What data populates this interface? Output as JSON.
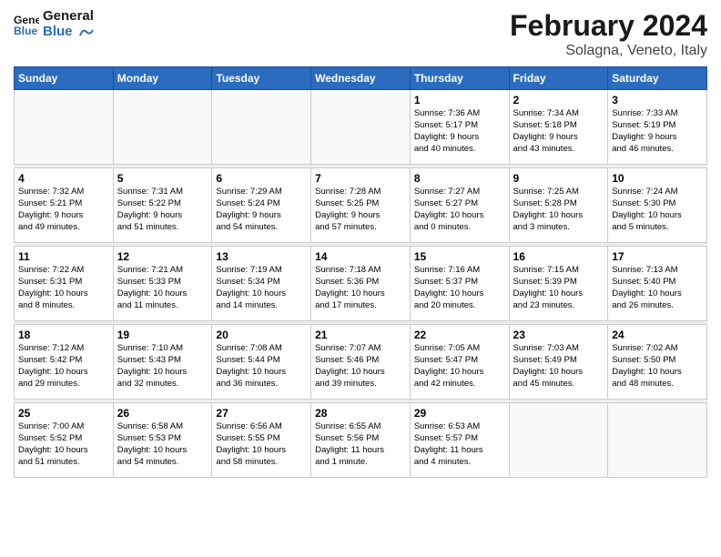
{
  "header": {
    "logo_line1": "General",
    "logo_line2": "Blue",
    "title": "February 2024",
    "subtitle": "Solagna, Veneto, Italy"
  },
  "days_of_week": [
    "Sunday",
    "Monday",
    "Tuesday",
    "Wednesday",
    "Thursday",
    "Friday",
    "Saturday"
  ],
  "weeks": [
    [
      {
        "day": "",
        "info": ""
      },
      {
        "day": "",
        "info": ""
      },
      {
        "day": "",
        "info": ""
      },
      {
        "day": "",
        "info": ""
      },
      {
        "day": "1",
        "info": "Sunrise: 7:36 AM\nSunset: 5:17 PM\nDaylight: 9 hours\nand 40 minutes."
      },
      {
        "day": "2",
        "info": "Sunrise: 7:34 AM\nSunset: 5:18 PM\nDaylight: 9 hours\nand 43 minutes."
      },
      {
        "day": "3",
        "info": "Sunrise: 7:33 AM\nSunset: 5:19 PM\nDaylight: 9 hours\nand 46 minutes."
      }
    ],
    [
      {
        "day": "4",
        "info": "Sunrise: 7:32 AM\nSunset: 5:21 PM\nDaylight: 9 hours\nand 49 minutes."
      },
      {
        "day": "5",
        "info": "Sunrise: 7:31 AM\nSunset: 5:22 PM\nDaylight: 9 hours\nand 51 minutes."
      },
      {
        "day": "6",
        "info": "Sunrise: 7:29 AM\nSunset: 5:24 PM\nDaylight: 9 hours\nand 54 minutes."
      },
      {
        "day": "7",
        "info": "Sunrise: 7:28 AM\nSunset: 5:25 PM\nDaylight: 9 hours\nand 57 minutes."
      },
      {
        "day": "8",
        "info": "Sunrise: 7:27 AM\nSunset: 5:27 PM\nDaylight: 10 hours\nand 0 minutes."
      },
      {
        "day": "9",
        "info": "Sunrise: 7:25 AM\nSunset: 5:28 PM\nDaylight: 10 hours\nand 3 minutes."
      },
      {
        "day": "10",
        "info": "Sunrise: 7:24 AM\nSunset: 5:30 PM\nDaylight: 10 hours\nand 5 minutes."
      }
    ],
    [
      {
        "day": "11",
        "info": "Sunrise: 7:22 AM\nSunset: 5:31 PM\nDaylight: 10 hours\nand 8 minutes."
      },
      {
        "day": "12",
        "info": "Sunrise: 7:21 AM\nSunset: 5:33 PM\nDaylight: 10 hours\nand 11 minutes."
      },
      {
        "day": "13",
        "info": "Sunrise: 7:19 AM\nSunset: 5:34 PM\nDaylight: 10 hours\nand 14 minutes."
      },
      {
        "day": "14",
        "info": "Sunrise: 7:18 AM\nSunset: 5:36 PM\nDaylight: 10 hours\nand 17 minutes."
      },
      {
        "day": "15",
        "info": "Sunrise: 7:16 AM\nSunset: 5:37 PM\nDaylight: 10 hours\nand 20 minutes."
      },
      {
        "day": "16",
        "info": "Sunrise: 7:15 AM\nSunset: 5:39 PM\nDaylight: 10 hours\nand 23 minutes."
      },
      {
        "day": "17",
        "info": "Sunrise: 7:13 AM\nSunset: 5:40 PM\nDaylight: 10 hours\nand 26 minutes."
      }
    ],
    [
      {
        "day": "18",
        "info": "Sunrise: 7:12 AM\nSunset: 5:42 PM\nDaylight: 10 hours\nand 29 minutes."
      },
      {
        "day": "19",
        "info": "Sunrise: 7:10 AM\nSunset: 5:43 PM\nDaylight: 10 hours\nand 32 minutes."
      },
      {
        "day": "20",
        "info": "Sunrise: 7:08 AM\nSunset: 5:44 PM\nDaylight: 10 hours\nand 36 minutes."
      },
      {
        "day": "21",
        "info": "Sunrise: 7:07 AM\nSunset: 5:46 PM\nDaylight: 10 hours\nand 39 minutes."
      },
      {
        "day": "22",
        "info": "Sunrise: 7:05 AM\nSunset: 5:47 PM\nDaylight: 10 hours\nand 42 minutes."
      },
      {
        "day": "23",
        "info": "Sunrise: 7:03 AM\nSunset: 5:49 PM\nDaylight: 10 hours\nand 45 minutes."
      },
      {
        "day": "24",
        "info": "Sunrise: 7:02 AM\nSunset: 5:50 PM\nDaylight: 10 hours\nand 48 minutes."
      }
    ],
    [
      {
        "day": "25",
        "info": "Sunrise: 7:00 AM\nSunset: 5:52 PM\nDaylight: 10 hours\nand 51 minutes."
      },
      {
        "day": "26",
        "info": "Sunrise: 6:58 AM\nSunset: 5:53 PM\nDaylight: 10 hours\nand 54 minutes."
      },
      {
        "day": "27",
        "info": "Sunrise: 6:56 AM\nSunset: 5:55 PM\nDaylight: 10 hours\nand 58 minutes."
      },
      {
        "day": "28",
        "info": "Sunrise: 6:55 AM\nSunset: 5:56 PM\nDaylight: 11 hours\nand 1 minute."
      },
      {
        "day": "29",
        "info": "Sunrise: 6:53 AM\nSunset: 5:57 PM\nDaylight: 11 hours\nand 4 minutes."
      },
      {
        "day": "",
        "info": ""
      },
      {
        "day": "",
        "info": ""
      }
    ]
  ]
}
